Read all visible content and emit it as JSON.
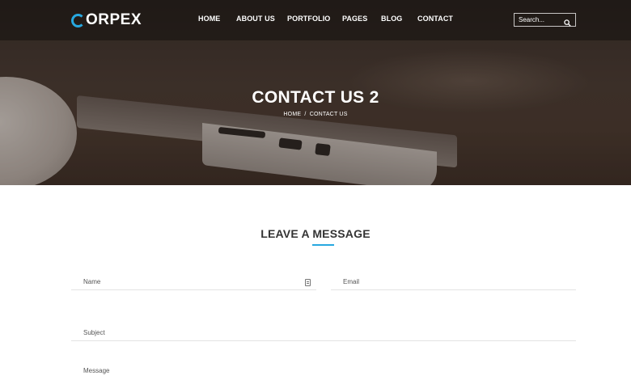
{
  "brand": {
    "logo_text": "ORPEX",
    "logo_letter_icon": "c-logo-mark",
    "accent_color": "#27a8e0"
  },
  "nav": {
    "items": [
      {
        "label": "HOME"
      },
      {
        "label": "ABOUT US"
      },
      {
        "label": "PORTFOLIO"
      },
      {
        "label": "PAGES"
      },
      {
        "label": "BLOG"
      },
      {
        "label": "CONTACT"
      }
    ],
    "search": {
      "placeholder": "Search...",
      "icon": "search-icon"
    }
  },
  "hero": {
    "title": "CONTACT US 2",
    "breadcrumb": {
      "home": "HOME",
      "separator": "/",
      "current": "CONTACT US"
    }
  },
  "form": {
    "title": "LEAVE A MESSAGE",
    "name_placeholder": "Name",
    "email_placeholder": "Email",
    "subject_placeholder": "Subject",
    "message_placeholder": "Message"
  }
}
